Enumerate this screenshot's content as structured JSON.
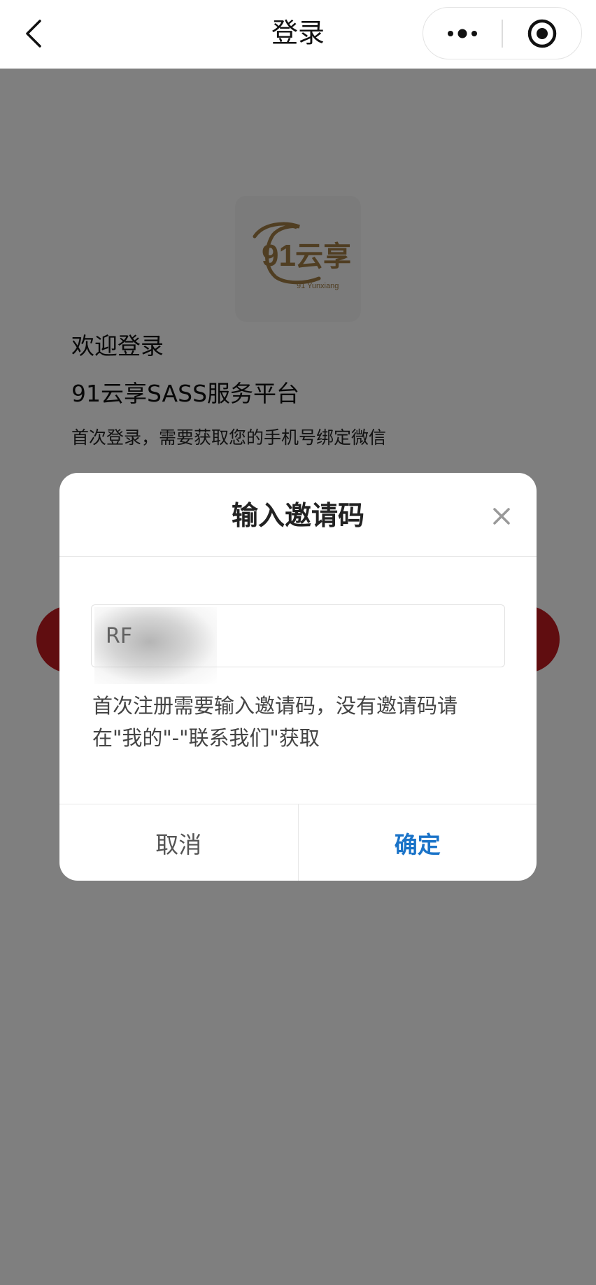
{
  "navbar": {
    "title": "登录"
  },
  "login_page": {
    "logo": {
      "number": "91",
      "name": "云享",
      "subtitle": "91 Yunxiang"
    },
    "welcome": "欢迎登录",
    "platform": "91云享SASS服务平台",
    "hint": "首次登录，需要获取您的手机号绑定微信"
  },
  "dialog": {
    "title": "输入邀请码",
    "input_value": "RF",
    "description": "首次注册需要输入邀请码，没有邀请码请在\"我的\"-\"联系我们\"获取",
    "cancel_label": "取消",
    "confirm_label": "确定"
  },
  "colors": {
    "brand_red": "#c01a20",
    "confirm_blue": "#1a73c8",
    "logo_gold": "#a07d45"
  },
  "icons": [
    "back-arrow-icon",
    "more-dots-icon",
    "close-miniprogram-icon",
    "close-icon"
  ]
}
